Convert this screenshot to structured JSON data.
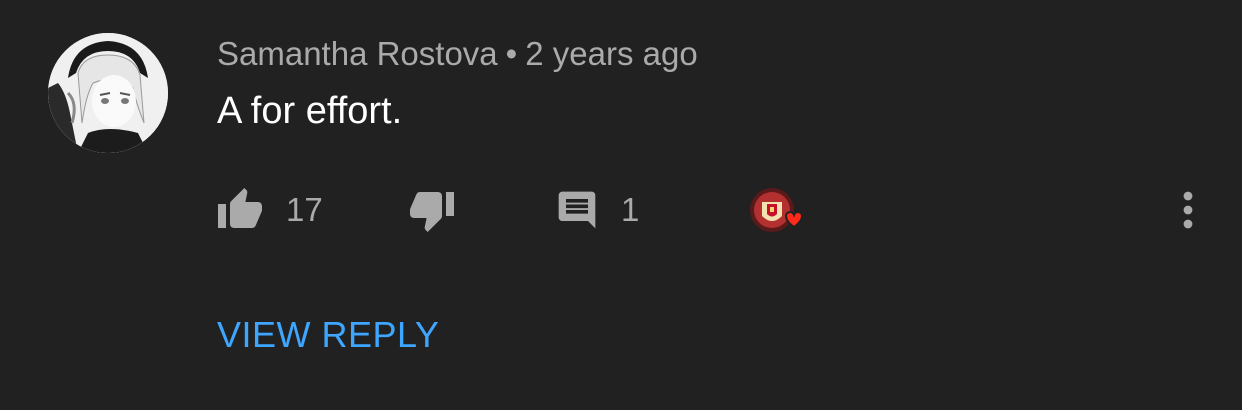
{
  "comment": {
    "author": "Samantha Rostova",
    "separator": "•",
    "time": "2 years ago",
    "text": "A for effort.",
    "likes": "17",
    "replies": "1",
    "view_reply_label": "VIEW REPLY"
  },
  "icons": {
    "like": "thumbs-up-icon",
    "dislike": "thumbs-down-icon",
    "reply": "comment-icon",
    "hearted": "creator-heart-icon",
    "more": "more-vertical-icon"
  },
  "colors": {
    "background": "#212121",
    "meta_text": "#aaaaaa",
    "body_text": "#ffffff",
    "link": "#3ea6ff",
    "heart": "#ff0000"
  }
}
